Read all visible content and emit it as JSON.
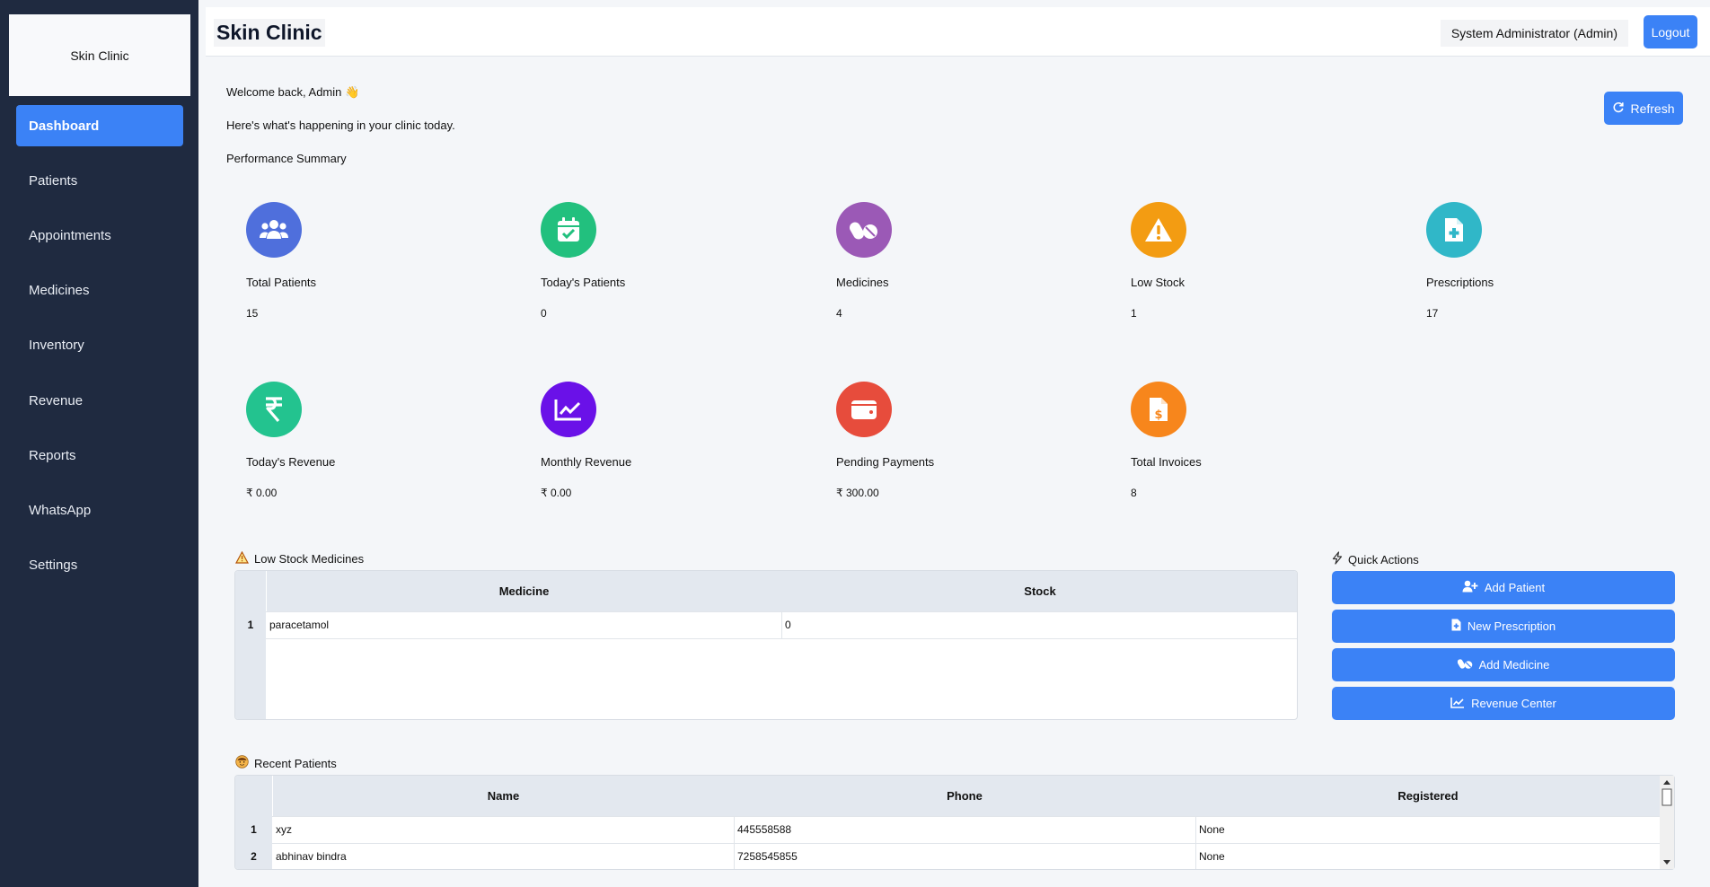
{
  "sidebar": {
    "logo_text": "Skin Clinic",
    "items": [
      {
        "label": "Dashboard",
        "active": true
      },
      {
        "label": "Patients"
      },
      {
        "label": "Appointments"
      },
      {
        "label": "Medicines"
      },
      {
        "label": "Inventory"
      },
      {
        "label": "Revenue"
      },
      {
        "label": "Reports"
      },
      {
        "label": "WhatsApp"
      },
      {
        "label": "Settings"
      }
    ]
  },
  "header": {
    "title": "Skin Clinic",
    "user": "System Administrator (Admin)",
    "logout_label": "Logout"
  },
  "main": {
    "welcome": "Welcome back, Admin 👋",
    "subtitle": "Here's what's happening in your clinic today.",
    "section_title": "Performance Summary",
    "refresh_label": "Refresh"
  },
  "stats": [
    {
      "label": "Total Patients",
      "value": "15",
      "icon": "users-icon",
      "color": "#4f6fdc"
    },
    {
      "label": "Today's Patients",
      "value": "0",
      "icon": "calendar-check-icon",
      "color": "#22c07e"
    },
    {
      "label": "Medicines",
      "value": "4",
      "icon": "pills-icon",
      "color": "#9b59b6"
    },
    {
      "label": "Low Stock",
      "value": "1",
      "icon": "warning-icon",
      "color": "#f39c12"
    },
    {
      "label": "Prescriptions",
      "value": "17",
      "icon": "prescription-file-icon",
      "color": "#30b7c8"
    },
    {
      "label": "Today's Revenue",
      "value": "₹ 0.00",
      "icon": "rupee-icon",
      "color": "#23c38f"
    },
    {
      "label": "Monthly Revenue",
      "value": "₹ 0.00",
      "icon": "chart-line-icon",
      "color": "#6a11e8"
    },
    {
      "label": "Pending Payments",
      "value": "₹ 300.00",
      "icon": "wallet-icon",
      "color": "#e74c3c"
    },
    {
      "label": "Total Invoices",
      "value": "8",
      "icon": "invoice-icon",
      "color": "#f7861c"
    }
  ],
  "low_stock": {
    "title": "Low Stock Medicines",
    "columns": [
      "Medicine",
      "Stock"
    ],
    "rows": [
      {
        "index": "1",
        "medicine": "paracetamol",
        "stock": "0"
      }
    ]
  },
  "quick_actions": {
    "title": "Quick Actions",
    "buttons": [
      {
        "label": "Add Patient",
        "icon": "user-plus-icon"
      },
      {
        "label": "New Prescription",
        "icon": "file-medical-icon"
      },
      {
        "label": "Add Medicine",
        "icon": "pills-icon"
      },
      {
        "label": "Revenue Center",
        "icon": "chart-line-icon"
      }
    ]
  },
  "recent_patients": {
    "title": "Recent Patients",
    "columns": [
      "Name",
      "Phone",
      "Registered"
    ],
    "rows": [
      {
        "index": "1",
        "name": "xyz",
        "phone": "445558588",
        "registered": "None"
      },
      {
        "index": "2",
        "name": "abhinav bindra",
        "phone": "7258545855",
        "registered": "None"
      }
    ]
  }
}
